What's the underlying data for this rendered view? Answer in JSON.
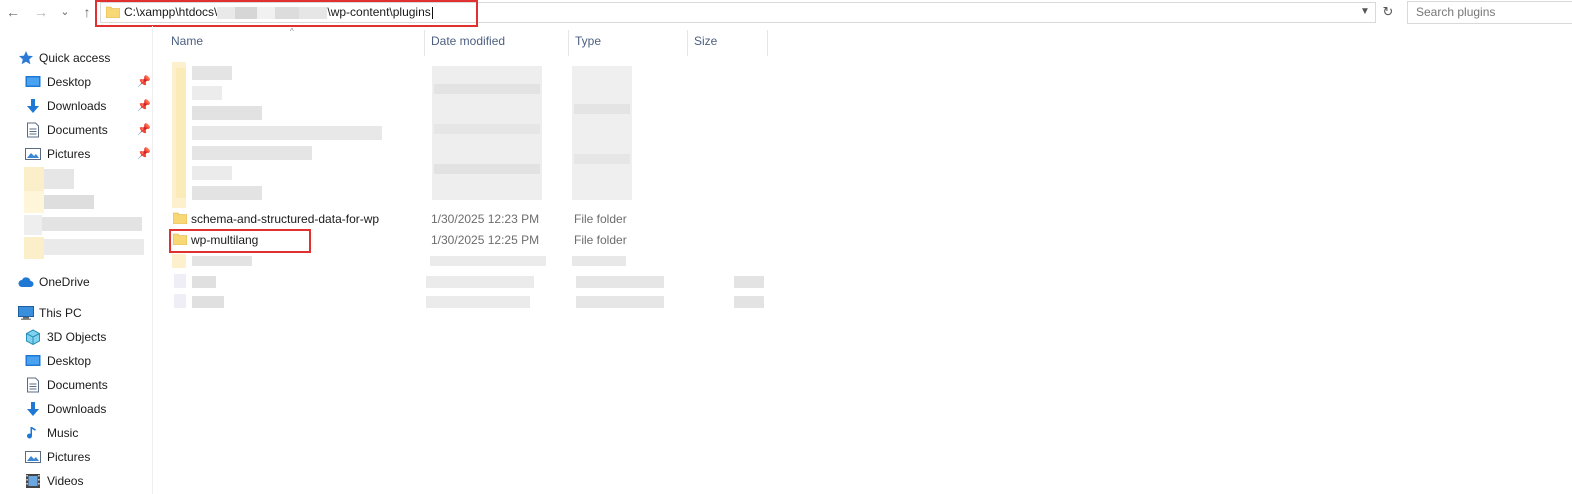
{
  "toolbar": {
    "back_glyph": "←",
    "forward_glyph": "→",
    "recent_glyph": "⌄",
    "up_glyph": "↑",
    "refresh_glyph": "↻"
  },
  "address_bar": {
    "path_start": "C:\\xampp\\htdocs\\",
    "path_end": "\\wp-content\\plugins",
    "folder_icon": "folder-icon",
    "highlight_color": "#e03030"
  },
  "search": {
    "placeholder": "Search plugins"
  },
  "columns": [
    "Name",
    "Date modified",
    "Type",
    "Size"
  ],
  "sidebar": {
    "quick_access": "Quick access",
    "pinned": [
      {
        "label": "Desktop",
        "icon": "desktop-icon"
      },
      {
        "label": "Downloads",
        "icon": "download-icon"
      },
      {
        "label": "Documents",
        "icon": "documents-icon"
      },
      {
        "label": "Pictures",
        "icon": "pictures-icon"
      }
    ],
    "onedrive": "OneDrive",
    "this_pc": "This PC",
    "pc_items": [
      {
        "label": "3D Objects",
        "icon": "3d-objects-icon"
      },
      {
        "label": "Desktop",
        "icon": "desktop-icon"
      },
      {
        "label": "Documents",
        "icon": "documents-icon"
      },
      {
        "label": "Downloads",
        "icon": "download-icon"
      },
      {
        "label": "Music",
        "icon": "music-icon"
      },
      {
        "label": "Pictures",
        "icon": "pictures-icon"
      },
      {
        "label": "Videos",
        "icon": "videos-icon"
      }
    ]
  },
  "files": [
    {
      "name": "schema-and-structured-data-for-wp",
      "date": "1/30/2025 12:23 PM",
      "type": "File folder"
    },
    {
      "name": "wp-multilang",
      "date": "1/30/2025 12:25 PM",
      "type": "File folder"
    }
  ],
  "colors": {
    "folder": "#f8d775",
    "folder_dark": "#e8b84a",
    "accent": "#1e6fd9",
    "annotation": "#e03030"
  }
}
